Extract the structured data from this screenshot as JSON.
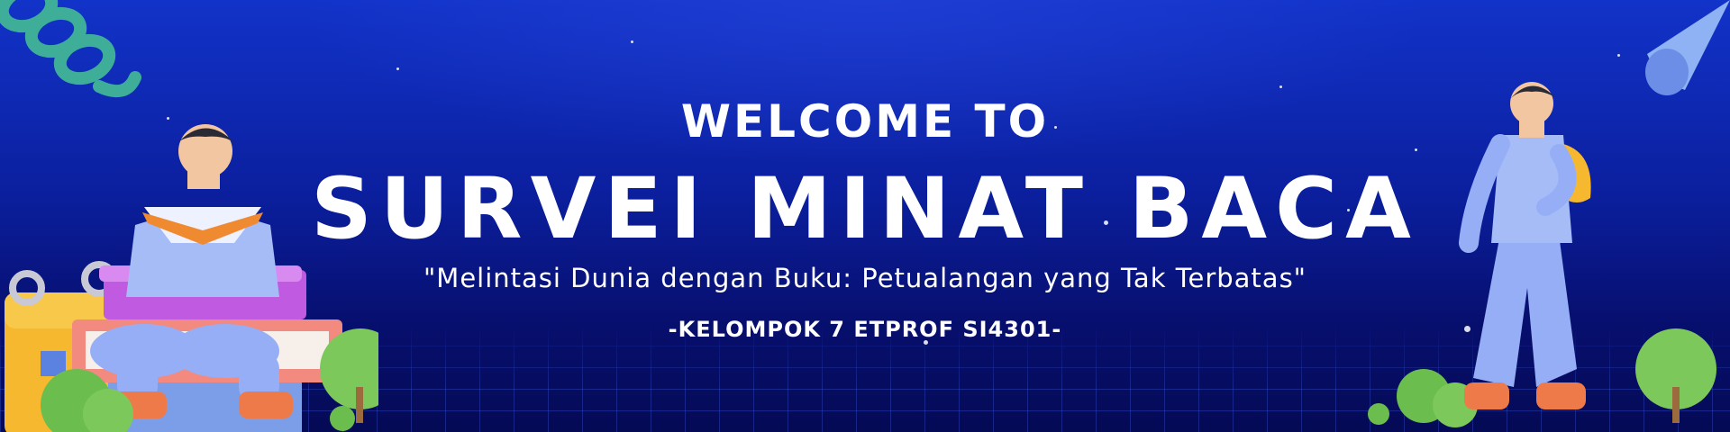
{
  "banner": {
    "welcome": "WELCOME TO",
    "title": "SURVEI MINAT BACA",
    "tagline": "\"Melintasi Dunia dengan Buku: Petualangan yang Tak Terbatas\"",
    "group": "-KELOMPOK 7 ETPROF SI4301-"
  },
  "colors": {
    "background_top": "#1233c9",
    "background_bottom": "#050a55",
    "text": "#ffffff",
    "character_suit": "#8ea7f5",
    "shoes": "#ee7a4a",
    "bush": "#7cc85a"
  },
  "decorations": [
    "spring-coil-icon",
    "cone-icon",
    "book-stack-icon",
    "calendar-icon",
    "bush-icon",
    "reading-boy-figure",
    "walking-boy-figure"
  ]
}
